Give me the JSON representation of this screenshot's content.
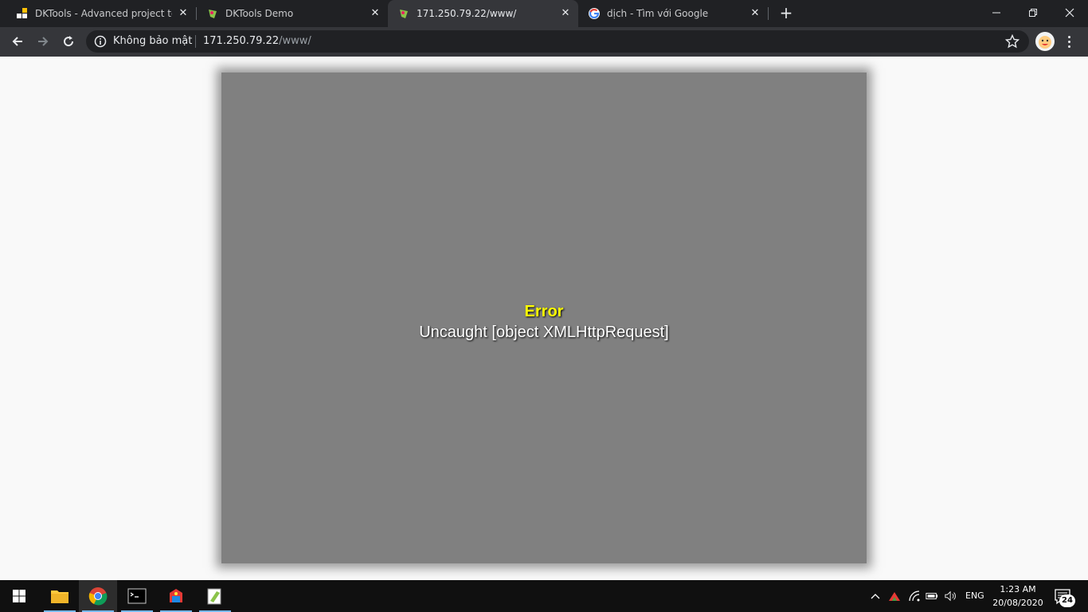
{
  "browser": {
    "tabs": [
      {
        "title": "DKTools - Advanced project testi",
        "icon": "dktools-logo-icon",
        "active": false
      },
      {
        "title": "DKTools Demo",
        "icon": "rpg-game-icon",
        "active": false
      },
      {
        "title": "171.250.79.22/www/",
        "icon": "rpg-game-icon",
        "active": true
      },
      {
        "title": "dịch - Tìm với Google",
        "icon": "google-icon",
        "active": false
      }
    ],
    "omnibox": {
      "security_label": "Không bảo mật",
      "url_host": "171.250.79.22",
      "url_path": "/www/"
    }
  },
  "page": {
    "error_title": "Error",
    "error_message": "Uncaught [object XMLHttpRequest]"
  },
  "taskbar": {
    "language": "ENG",
    "time": "1:23 AM",
    "date": "20/08/2020",
    "notification_count": "24"
  },
  "colors": {
    "chrome_dark": "#202124",
    "toolbar": "#35363a",
    "error_panel": "#808080",
    "error_title": "#ffff00",
    "taskbar": "#101010"
  }
}
